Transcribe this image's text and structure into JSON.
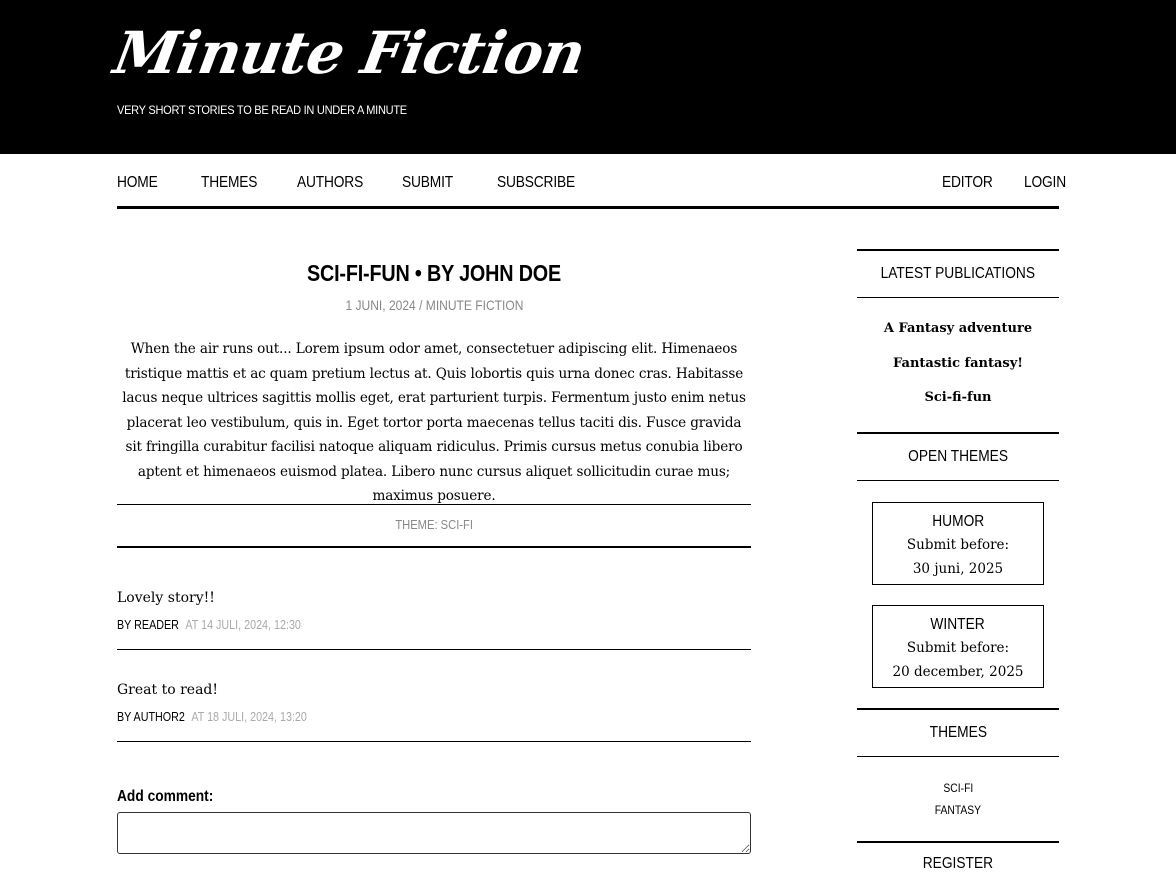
{
  "site": {
    "title": "Minute Fiction",
    "tagline": "VERY SHORT STORIES TO BE READ IN UNDER A MINUTE"
  },
  "nav": {
    "left": [
      "HOME",
      "THEMES",
      "AUTHORS",
      "SUBMIT",
      "SUBSCRIBE"
    ],
    "right": [
      "EDITOR",
      "LOGIN"
    ]
  },
  "post": {
    "title": "SCI-FI-FUN • BY JOHN DOE",
    "meta": "1 JUNI, 2024 / MINUTE FICTION",
    "body": "When the air runs out... Lorem ipsum odor amet, consectetuer adipiscing elit. Himenaeos tristique mattis et ac quam pretium lectus at. Quis lobortis quis urna donec cras. Habitasse lacus neque ultrices sagittis mollis eget, erat parturient turpis. Fermentum justo enim netus placerat leo vestibulum, quis in. Eget tortor porta maecenas tellus taciti dis. Fusce gravida sit fringilla curabitur facilisi natoque aliquam ridiculus. Primis cursus metus conubia libero aptent et himenaeos euismod platea. Libero nunc cursus aliquet sollicitudin curae mus; maximus posuere.",
    "theme": "THEME: SCI-FI"
  },
  "comments": [
    {
      "text": "Lovely story!!",
      "by": "BY READER",
      "at": "AT 14 JULI, 2024, 12:30"
    },
    {
      "text": "Great to read!",
      "by": "BY AUTHOR2",
      "at": "AT 18 JULI, 2024, 13:20"
    }
  ],
  "add_comment": {
    "label": "Add comment:"
  },
  "sidebar": {
    "latest_heading": "LATEST PUBLICATIONS",
    "latest": [
      "A Fantasy adventure",
      "Fantastic fantasy!",
      "Sci-fi-fun"
    ],
    "open_heading": "OPEN THEMES",
    "open_themes": [
      {
        "name": "HUMOR",
        "label": "Submit before:",
        "date": "30 juni, 2025"
      },
      {
        "name": "WINTER",
        "label": "Submit before:",
        "date": "20 december, 2025"
      }
    ],
    "themes_heading": "THEMES",
    "themes": [
      "SCI-FI",
      "FANTASY"
    ],
    "register_heading": "REGISTER"
  }
}
